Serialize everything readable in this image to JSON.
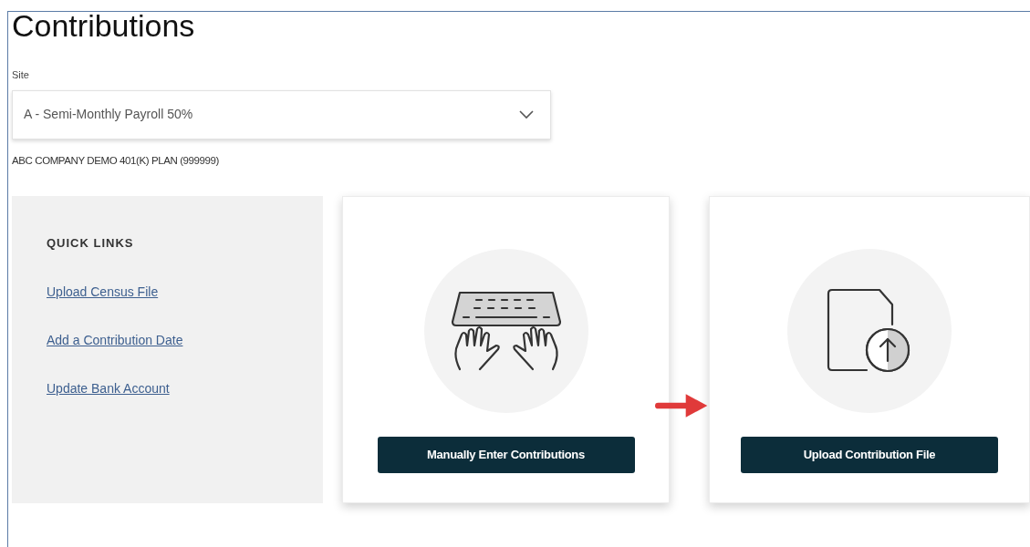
{
  "page": {
    "title": "Contributions"
  },
  "site_select": {
    "label": "Site",
    "value": "A - Semi-Monthly Payroll 50%"
  },
  "plan": "ABC COMPANY DEMO 401(K) PLAN (999999)",
  "quick_links": {
    "heading": "QUICK LINKS",
    "links": [
      "Upload Census File",
      "Add a Contribution Date",
      "Update Bank Account"
    ]
  },
  "cards": [
    {
      "kind": "keyboard",
      "button": "Manually Enter Contributions"
    },
    {
      "kind": "upload",
      "button": "Upload Contribution File"
    }
  ]
}
